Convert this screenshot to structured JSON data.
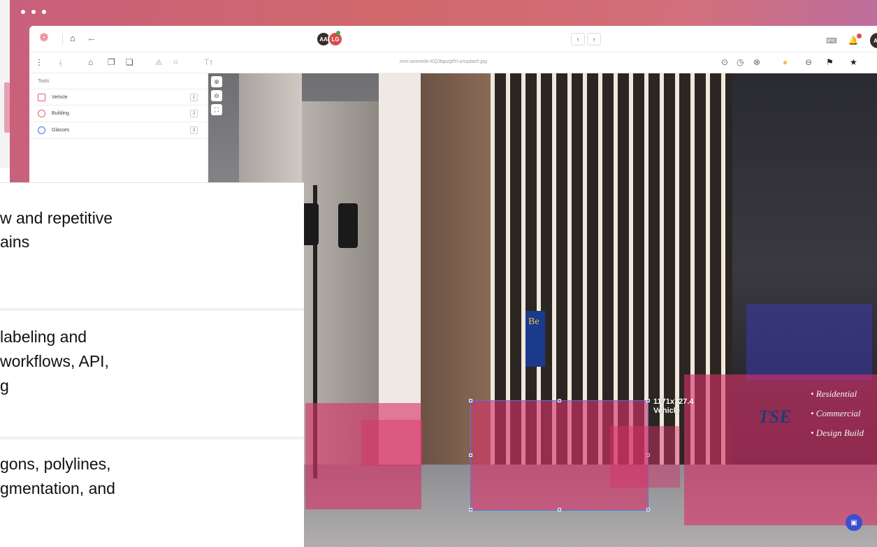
{
  "window": {
    "filename": "ines-azevedo-KQJtapzgfXI-unsplash.jpg"
  },
  "header": {
    "avatars": [
      "AA",
      "LG"
    ],
    "me": "AA"
  },
  "tools": {
    "title": "Tools",
    "items": [
      {
        "label": "Vehicle",
        "key": "1",
        "shape": "rectangle"
      },
      {
        "label": "Building",
        "key": "2",
        "shape": "circle"
      },
      {
        "label": "Glasses",
        "key": "3",
        "shape": "circle"
      }
    ]
  },
  "annotation": {
    "size_label": "1171x727.4",
    "class_label": "Vehicle"
  },
  "van": {
    "logo": "TSE",
    "lines": [
      "• Residential",
      "• Commercial",
      "• Design Build"
    ]
  },
  "banner": {
    "text": "Be"
  },
  "cards": [
    {
      "lines": [
        "w and repetitive",
        "ains"
      ]
    },
    {
      "lines": [
        " labeling and",
        "workflows, API,",
        "g"
      ]
    },
    {
      "lines": [
        "gons, polylines,",
        "gmentation, and"
      ]
    }
  ],
  "colors": {
    "annotation": "#d73269",
    "selection": "#4a7be0",
    "brand": "#e05a70"
  },
  "icons": {
    "toolbar": [
      "menu-icon",
      "download-icon",
      "building-icon",
      "copy-icon",
      "paste-icon",
      "polygon-icon",
      "crop-icon",
      "text-icon"
    ],
    "right": [
      "check-circle-icon",
      "clock-icon",
      "close-circle-icon",
      "lightbulb-icon",
      "comment-icon",
      "flag-icon",
      "star-icon"
    ]
  }
}
